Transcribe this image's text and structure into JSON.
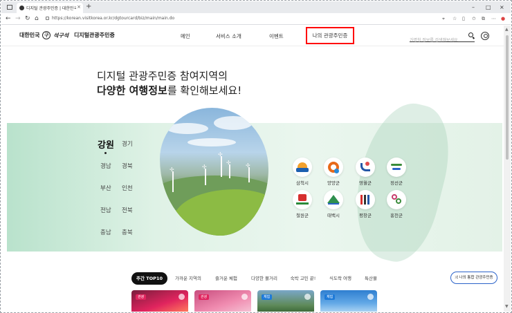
{
  "browser": {
    "tab_title": "디지털 관광주민증 | 대한민국 구석구석",
    "tab_close": "×",
    "new_tab": "+",
    "url": "https://korean.visitkorea.or.kr/dgtourcard/biz/main/main.do",
    "window_controls": [
      "–",
      "□",
      "×"
    ]
  },
  "header": {
    "logo_prefix": "대한민국",
    "logo_mark": "구",
    "logo_script": "석구석",
    "logo_service": "디지털관광주민증",
    "nav": [
      "메인",
      "서비스 소개",
      "이벤트",
      "나의 관광주민증"
    ],
    "search_placeholder": "가명칭 정보를 검색해보세요"
  },
  "hero": {
    "line1": "디지털 관광주민증 참여지역의",
    "line2_bold": "다양한 여행정보",
    "line2_rest": "를 확인해보세요!"
  },
  "regions": {
    "active": "강원",
    "items": [
      "경기",
      "경남",
      "경북",
      "부산",
      "인천",
      "전남",
      "전북",
      "충남",
      "충북"
    ]
  },
  "cities": [
    {
      "name": "삼척시",
      "color": "#f3a12d"
    },
    {
      "name": "양양군",
      "color": "#e86a1a"
    },
    {
      "name": "영월군",
      "color": "#2456a6"
    },
    {
      "name": "정선군",
      "color": "#3a8b3a"
    },
    {
      "name": "철원군",
      "color": "#d62f2f"
    },
    {
      "name": "태백시",
      "color": "#2f8f4e"
    },
    {
      "name": "평창군",
      "color": "#333333"
    },
    {
      "name": "홍천군",
      "color": "#c73a6b"
    }
  ],
  "chips": [
    "주간 TOP10",
    "가까운 지역의",
    "즐거운 체험",
    "다양한 볼거리",
    "숙박 고민 끝!",
    "식도락 여행",
    "특산물"
  ],
  "mycard_button": "나의 통합 관광주민증",
  "cards": [
    {
      "tag": "관광",
      "tag_color": "#e0245e"
    },
    {
      "tag": "관광",
      "tag_color": "#e0245e"
    },
    {
      "tag": "체험",
      "tag_color": "#1e7ad8"
    },
    {
      "tag": "체험",
      "tag_color": "#1e7ad8"
    }
  ]
}
